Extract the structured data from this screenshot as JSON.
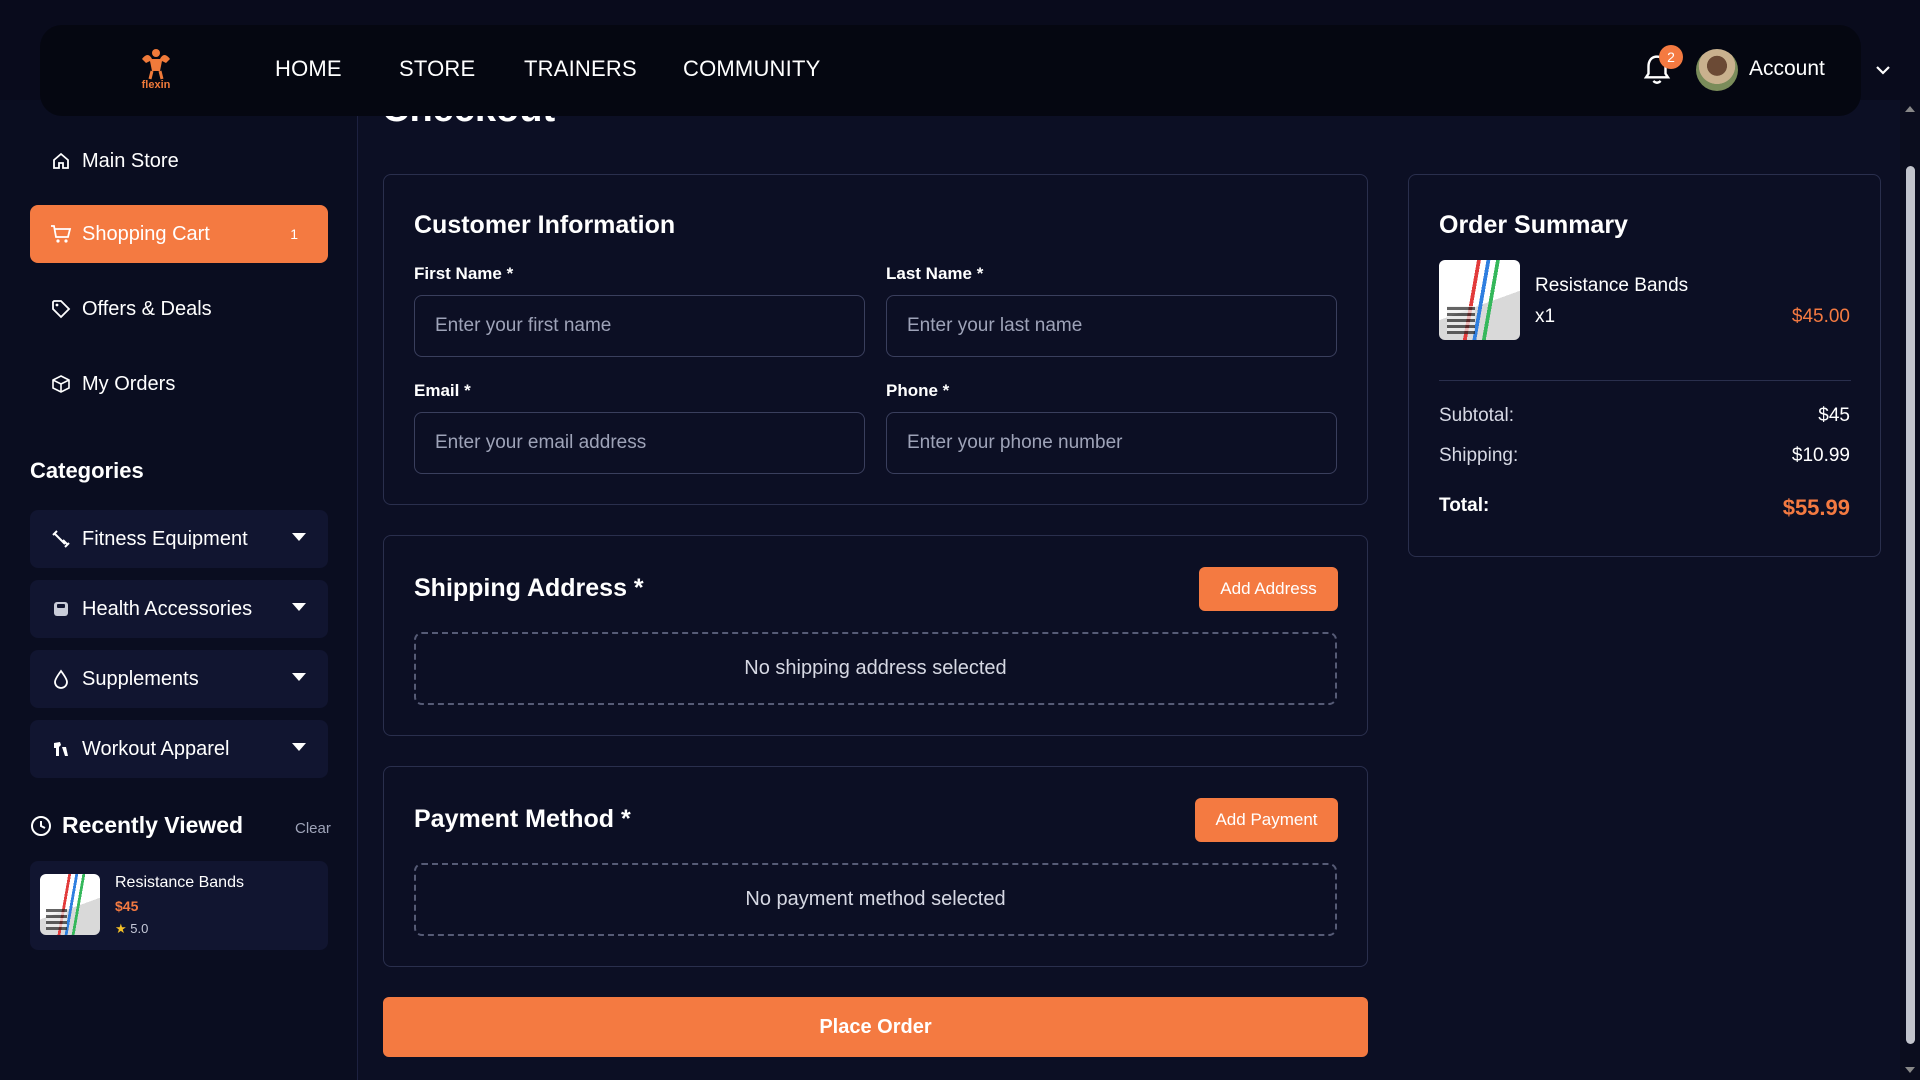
{
  "brand": {
    "logo_text": "flexin",
    "accent": "#f47a41"
  },
  "nav": {
    "links": [
      "HOME",
      "STORE",
      "TRAINERS",
      "COMMUNITY"
    ],
    "notification_count": "2",
    "account_label": "Account"
  },
  "sidebar": {
    "items": [
      {
        "label": "Main Store",
        "icon": "home-icon"
      },
      {
        "label": "Shopping Cart",
        "icon": "cart-icon",
        "count": "1",
        "active": true
      },
      {
        "label": "Offers & Deals",
        "icon": "tag-icon"
      },
      {
        "label": "My Orders",
        "icon": "box-icon"
      }
    ],
    "categories_heading": "Categories",
    "categories": [
      {
        "label": "Fitness Equipment",
        "icon": "dumbbell-icon"
      },
      {
        "label": "Health Accessories",
        "icon": "scale-icon"
      },
      {
        "label": "Supplements",
        "icon": "drop-icon"
      },
      {
        "label": "Workout Apparel",
        "icon": "shirt-icon"
      }
    ],
    "recently_viewed": {
      "heading": "Recently Viewed",
      "clear_label": "Clear",
      "item": {
        "name": "Resistance Bands",
        "price": "$45",
        "rating": "5.0"
      }
    }
  },
  "checkout": {
    "title": "Checkout",
    "customer_info": {
      "title": "Customer Information",
      "first_name_label": "First Name *",
      "first_name_placeholder": "Enter your first name",
      "last_name_label": "Last Name *",
      "last_name_placeholder": "Enter your last name",
      "email_label": "Email *",
      "email_placeholder": "Enter your email address",
      "phone_label": "Phone *",
      "phone_placeholder": "Enter your phone number"
    },
    "shipping": {
      "title": "Shipping Address *",
      "add_label": "Add Address",
      "empty_text": "No shipping address selected"
    },
    "payment": {
      "title": "Payment Method *",
      "add_label": "Add Payment",
      "empty_text": "No payment method selected"
    },
    "place_order_label": "Place Order"
  },
  "order_summary": {
    "title": "Order Summary",
    "item": {
      "name": "Resistance Bands",
      "qty": "x1",
      "price": "$45.00"
    },
    "subtotal_label": "Subtotal:",
    "subtotal_value": "$45",
    "shipping_label": "Shipping:",
    "shipping_value": "$10.99",
    "total_label": "Total:",
    "total_value": "$55.99"
  }
}
